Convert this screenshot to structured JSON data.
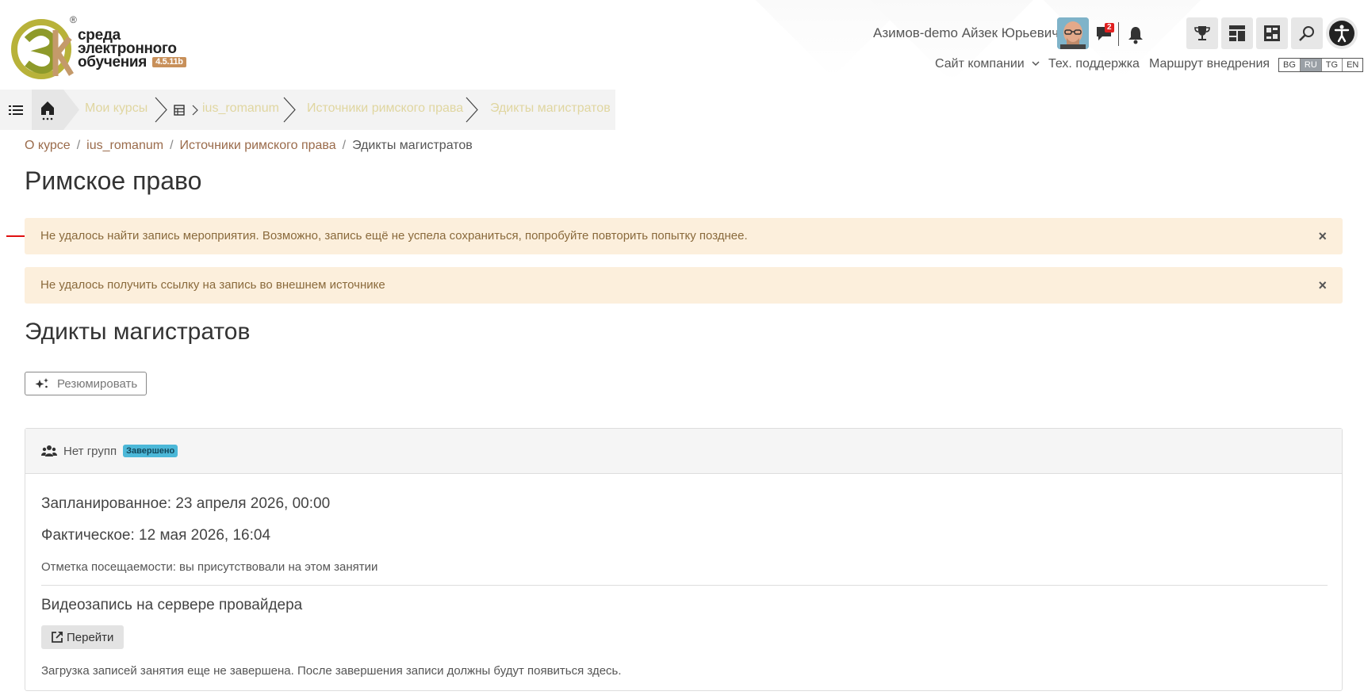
{
  "header": {
    "logo_text_line1": "среда",
    "logo_text_line2": "электронного",
    "logo_text_line3": "обучения",
    "logo_version": "4.5.11b",
    "logo_reg": "®",
    "user_name": "Азимов-demo Айзек Юрьевич",
    "messages_count": "2",
    "nav": {
      "company_site": "Сайт компании",
      "support": "Тех. поддержка",
      "route": "Маршрут внедрения"
    },
    "languages": [
      "BG",
      "RU",
      "TG",
      "EN"
    ],
    "active_language": "RU"
  },
  "crumbbar": {
    "items": [
      "Мои курсы",
      "ius_romanum",
      "Источники римского права",
      "Эдикты магистратов"
    ]
  },
  "breadcrumb": {
    "items": [
      "О курсе",
      "ius_romanum",
      "Источники римского права"
    ],
    "current": "Эдикты магистратов",
    "separator": "/"
  },
  "page": {
    "course_title": "Римское право",
    "activity_title": "Эдикты магистратов"
  },
  "alerts": [
    {
      "text": "Не удалось найти запись мероприятия. Возможно, запись ещё не успела сохраниться, попробуйте повторить попытку позднее.",
      "close": "×"
    },
    {
      "text": "Не удалось получить ссылку на запись во внешнем источнике",
      "close": "×"
    }
  ],
  "resume_button": "Резюмировать",
  "session": {
    "groups": "Нет групп",
    "status_badge": "Завершено",
    "planned": "Запланированное: 23 апреля 2026, 00:00",
    "actual": "Фактическое: 12 мая 2026, 16:04",
    "attendance": "Отметка посещаемости: вы присутствовали на этом занятии",
    "recording_title": "Видеозапись на сервере провайдера",
    "go_button": "Перейти",
    "recording_note": "Загрузка записей занятия еще не завершена. После завершения записи должны будут появиться здесь."
  },
  "colors": {
    "alert_bg": "#fcefdc",
    "alert_text": "#8a6a3c",
    "badge": "#4cb8d8",
    "link": "#9a6b4b",
    "crumb_text": "#e0d6a0"
  }
}
